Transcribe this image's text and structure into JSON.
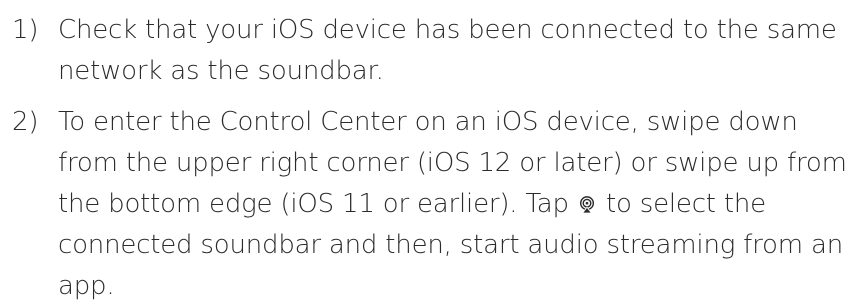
{
  "steps": [
    {
      "number": "1)",
      "text": "Check that your iOS device has been connected to the same network as the soundbar."
    },
    {
      "number": "2)",
      "text_before_icon": "To enter the Control Center on an iOS device, swipe down from the upper right corner (iOS 12 or later) or swipe up from the bottom edge (iOS 11 or earlier). Tap ",
      "icon": "airplay-audio-icon",
      "text_after_icon": " to select the connected soundbar and then, start audio streaming from an app."
    }
  ]
}
